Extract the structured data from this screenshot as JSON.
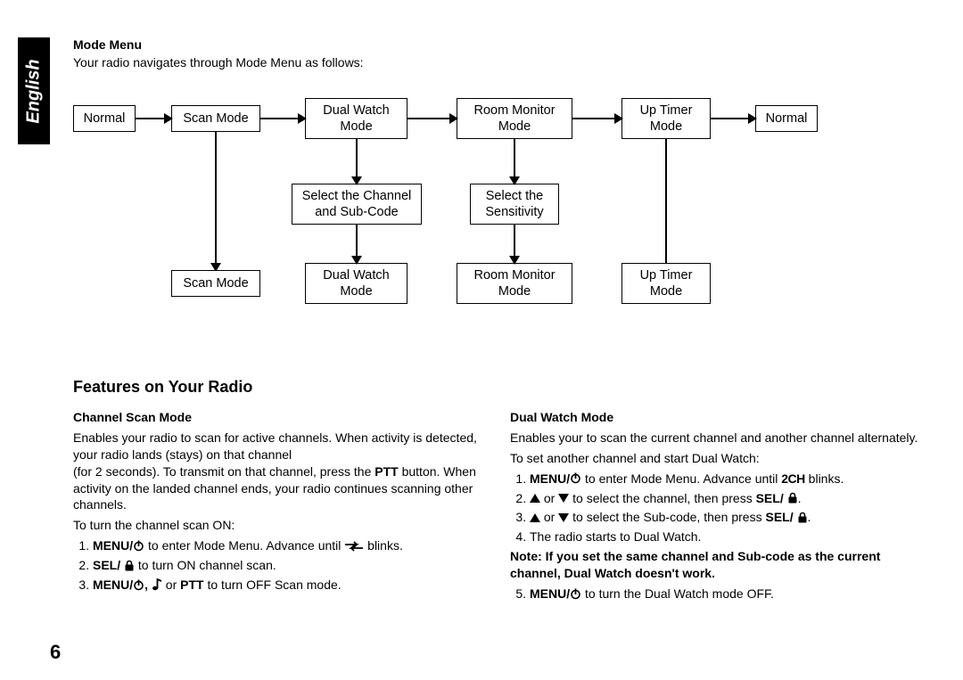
{
  "language_tab": "English",
  "mode_menu": {
    "title": "Mode Menu",
    "intro": "Your radio navigates through Mode Menu as follows:"
  },
  "diagram": {
    "row1": {
      "normal1": "Normal",
      "scan": "Scan Mode",
      "dual": "Dual Watch Mode",
      "room": "Room Monitor Mode",
      "timer": "Up Timer Mode",
      "normal2": "Normal"
    },
    "row2": {
      "select_ch": "Select the Channel and Sub-Code",
      "select_sens": "Select the Sensitivity"
    },
    "row3": {
      "scan": "Scan Mode",
      "dual": "Dual Watch Mode",
      "room": "Room Monitor Mode",
      "timer": "Up Timer Mode"
    }
  },
  "features": {
    "heading": "Features on Your Radio",
    "scan": {
      "title": "Channel Scan Mode",
      "p1": "Enables your radio to scan for active channels. When activity is detected, your radio lands (stays) on that channel",
      "p2": "(for 2 seconds). To transmit on that channel, press the ",
      "p2b": "PTT",
      "p3": " button. When activity on the landed channel ends, your radio continues scanning other channels.",
      "turn_on_intro": "To turn the channel scan ON:",
      "step1a": "MENU/",
      "step1b": " to enter Mode Menu. Advance until ",
      "step1c": " blinks.",
      "step2a": "SEL/ ",
      "step2b": " to turn ON channel scan.",
      "step3a": "MENU/",
      "step3b": ", ",
      "step3c": " or ",
      "step3d": "PTT",
      "step3e": " to turn OFF Scan mode."
    },
    "dual": {
      "title": "Dual Watch Mode",
      "p1": "Enables your to scan the current channel and another channel alternately.",
      "intro": "To set another channel and start Dual Watch:",
      "step1a": "MENU/",
      "step1b": " to enter Mode Menu. Advance until ",
      "step1c": " blinks.",
      "step2a": " or ",
      "step2b": " to select the channel, then press ",
      "step2c": "SEL/ ",
      "step3a": " or ",
      "step3b": " to select the Sub-code, then press ",
      "step3c": "SEL/ ",
      "step4": "The radio starts to Dual Watch.",
      "note": "Note: If you set the same channel and Sub-code as the current channel, Dual Watch doesn't work.",
      "step5a": "MENU/",
      "step5b": " to turn the Dual Watch mode OFF."
    }
  },
  "page_number": "6"
}
